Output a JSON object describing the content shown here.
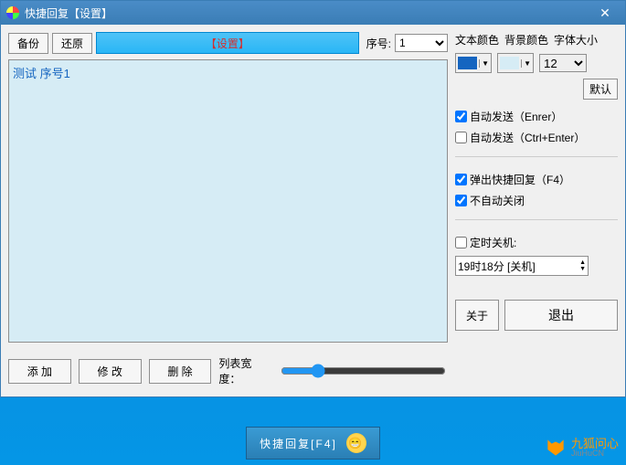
{
  "window": {
    "title": "快捷回复【设置】"
  },
  "toolbar": {
    "backup": "备份",
    "restore": "还原",
    "settings": "【设置】",
    "seq_label": "序号:",
    "seq_value": "1"
  },
  "editor": {
    "content": "测试 序号1"
  },
  "actions": {
    "add": "添 加",
    "edit": "修 改",
    "delete": "删 除",
    "width_label": "列表宽度："
  },
  "style_panel": {
    "text_color_label": "文本颜色",
    "bg_color_label": "背景颜色",
    "font_size_label": "字体大小",
    "text_color": "#1565c0",
    "bg_color": "#d6ecf5",
    "font_size": "12",
    "default_btn": "默认"
  },
  "options": {
    "auto_send_enter": {
      "label": "自动发送（Enrer）",
      "checked": true
    },
    "auto_send_ctrl": {
      "label": "自动发送（Ctrl+Enter）",
      "checked": false
    },
    "popup_f4": {
      "label": "弹出快捷回复（F4）",
      "checked": true
    },
    "no_auto_close": {
      "label": "不自动关闭",
      "checked": true
    },
    "timed_shutdown": {
      "label": "定时关机:",
      "checked": false
    },
    "shutdown_time": "19时18分 [关机]"
  },
  "footer": {
    "about": "关于",
    "exit": "退出"
  },
  "taskbar": {
    "label": "快捷回复[F4]"
  },
  "brand": {
    "name": "九狐问心",
    "sub": "JiuHuCN"
  }
}
